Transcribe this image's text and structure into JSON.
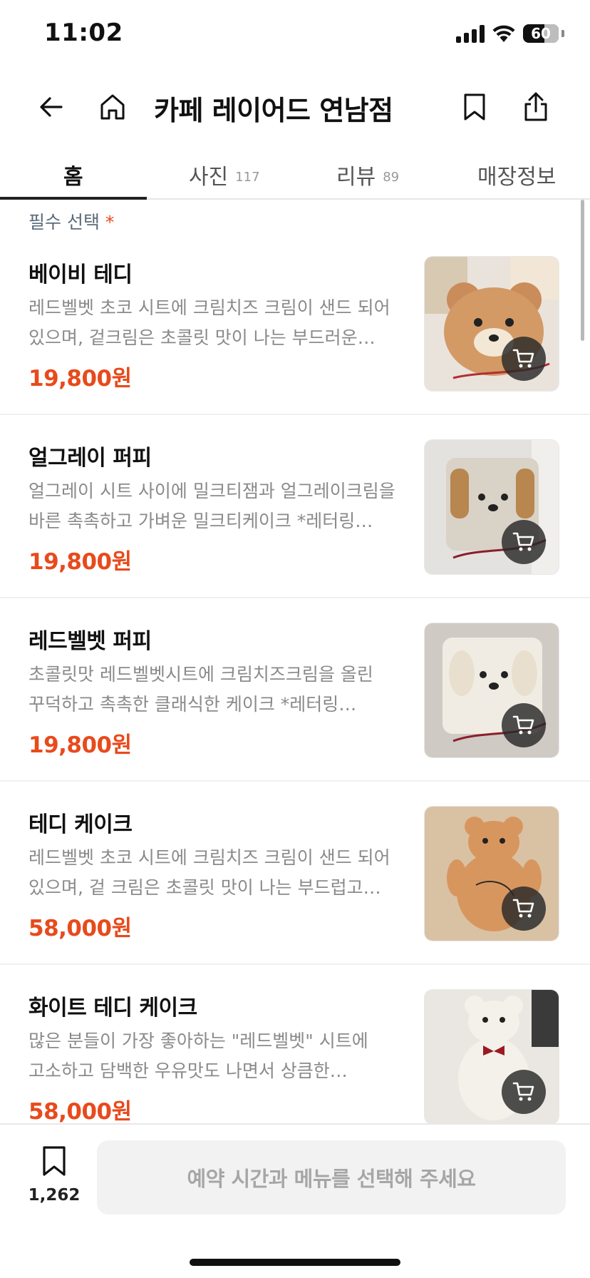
{
  "status_bar": {
    "time": "11:02",
    "battery": "60"
  },
  "header": {
    "title": "카페 레이어드 연남점"
  },
  "tabs": [
    {
      "label": "홈",
      "count": ""
    },
    {
      "label": "사진",
      "count": "117"
    },
    {
      "label": "리뷰",
      "count": "89"
    },
    {
      "label": "매장정보",
      "count": ""
    }
  ],
  "section": {
    "label": "필수 선택",
    "required_mark": "*"
  },
  "menu_items": [
    {
      "name": "베이비 테디",
      "description": "레드벨벳 초코 시트에 크림치즈 크림이 샌드 되어 있으며, 겉크림은 초콜릿 맛이 나는 부드러운 달콤한 …",
      "price": "19,800원"
    },
    {
      "name": "얼그레이 퍼피",
      "description": "얼그레이 시트 사이에 밀크티잼과 얼그레이크림을 바른 촉촉하고 가벼운 밀크티케이크  *레터링 가능…",
      "price": "19,800원"
    },
    {
      "name": "레드벨벳 퍼피",
      "description": "초콜릿맛 레드벨벳시트에 크림치즈크림을 올린 꾸덕하고 촉촉한 클래식한 케이크  *레터링 가능합니…",
      "price": "19,800원"
    },
    {
      "name": "테디 케이크",
      "description": "레드벨벳 초코 시트에 크림치즈 크림이 샌드 되어 있으며, 겉 크림은 초콜릿 맛이 나는 부드럽고 달콤한…",
      "price": "58,000원"
    },
    {
      "name": "화이트 테디 케이크",
      "description": "많은 분들이 가장 좋아하는 \"레드벨벳\" 시트에 고소하고 담백한 우유맛도 나면서 상큼한 크림치즈 맛…",
      "price": "58,000원"
    }
  ],
  "bottom_bar": {
    "bookmark_count": "1,262",
    "cta_label": "예약 시간과 메뉴를 선택해 주세요"
  },
  "colors": {
    "accent": "#e84a1c",
    "section_label": "#5a6b7b",
    "muted_text": "#8a8a8a"
  },
  "icons": [
    "back-arrow-icon",
    "home-icon",
    "bookmark-icon",
    "share-icon",
    "cart-icon"
  ]
}
